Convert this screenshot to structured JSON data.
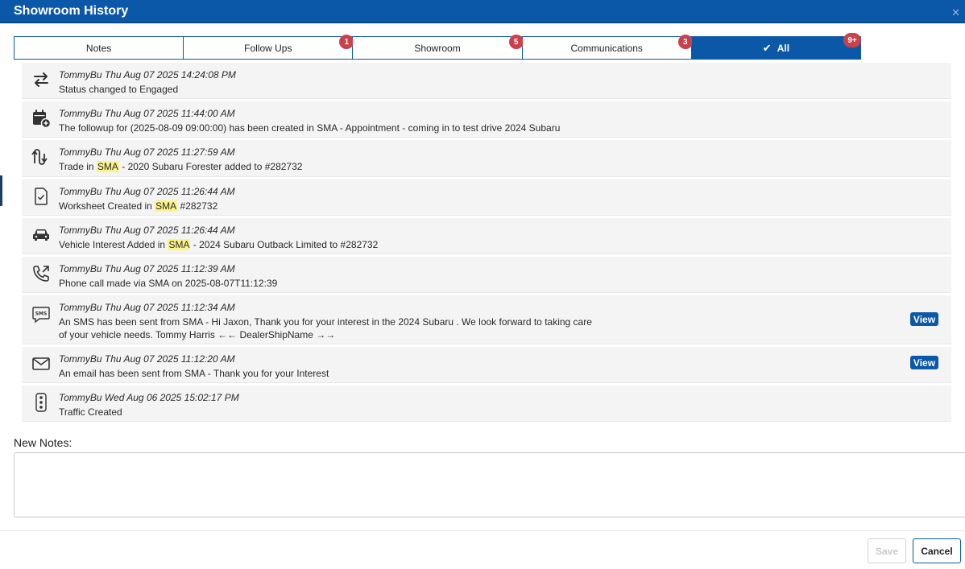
{
  "dialog": {
    "title": "Showroom History",
    "close_glyph": "✕"
  },
  "tabs": [
    {
      "label": "Notes",
      "badge": ""
    },
    {
      "label": "Follow Ups",
      "badge": "1"
    },
    {
      "label": "Showroom",
      "badge": "5"
    },
    {
      "label": "Communications",
      "badge": "3"
    },
    {
      "label": "All",
      "badge": "9+",
      "active": true
    }
  ],
  "feed": [
    {
      "icon": "swap-arrows-icon",
      "meta": "TommyBu Thu Aug 07 2025 14:24:08 PM",
      "text": "Status changed to Engaged"
    },
    {
      "icon": "calendar-add-icon",
      "meta": "TommyBu Thu Aug 07 2025 11:44:00 AM",
      "text": "The followup for (2025-08-09 09:00:00) has been created in SMA - Appointment - coming in to test drive 2024 Subaru"
    },
    {
      "icon": "trade-route-icon",
      "meta": "TommyBu Thu Aug 07 2025 11:27:59 AM",
      "text_pre": "Trade in ",
      "highlight": "SMA",
      "text_post": " - 2020 Subaru Forester added to #282732"
    },
    {
      "icon": "worksheet-check-icon",
      "meta": "TommyBu Thu Aug 07 2025 11:26:44 AM",
      "text_pre": "Worksheet Created in ",
      "highlight": "SMA",
      "text_post": " #282732"
    },
    {
      "icon": "car-icon",
      "meta": "TommyBu Thu Aug 07 2025 11:26:44 AM",
      "text_pre": "Vehicle Interest Added in ",
      "highlight": "SMA",
      "text_post": " - 2024 Subaru Outback Limited to #282732"
    },
    {
      "icon": "phone-outgoing-icon",
      "meta": "TommyBu Thu Aug 07 2025 11:12:39 AM",
      "text": "Phone call made via SMA on 2025-08-07T11:12:39"
    },
    {
      "icon": "sms-icon",
      "meta": "TommyBu Thu Aug 07 2025 11:12:34 AM",
      "text": "An SMS has been sent from SMA - Hi Jaxon, Thank you for your interest in the 2024 Subaru . We look forward to taking care of your vehicle needs. Tommy Harris ←← DealerShipName →→",
      "view": "View"
    },
    {
      "icon": "email-icon",
      "meta": "TommyBu Thu Aug 07 2025 11:12:20 AM",
      "text": "An email has been sent from SMA - Thank you for your Interest",
      "view": "View"
    },
    {
      "icon": "traffic-light-icon",
      "meta": "TommyBu Wed Aug 06 2025 15:02:17 PM",
      "text": "Traffic Created"
    }
  ],
  "notes": {
    "label": "New Notes:",
    "value": "",
    "placeholder": ""
  },
  "footer": {
    "save_label": "Save",
    "cancel_label": "Cancel"
  },
  "colors": {
    "brand": "#0b57a8",
    "badge": "#c9424b",
    "highlight": "#fbf489",
    "row_bg": "#f4f4f5"
  }
}
